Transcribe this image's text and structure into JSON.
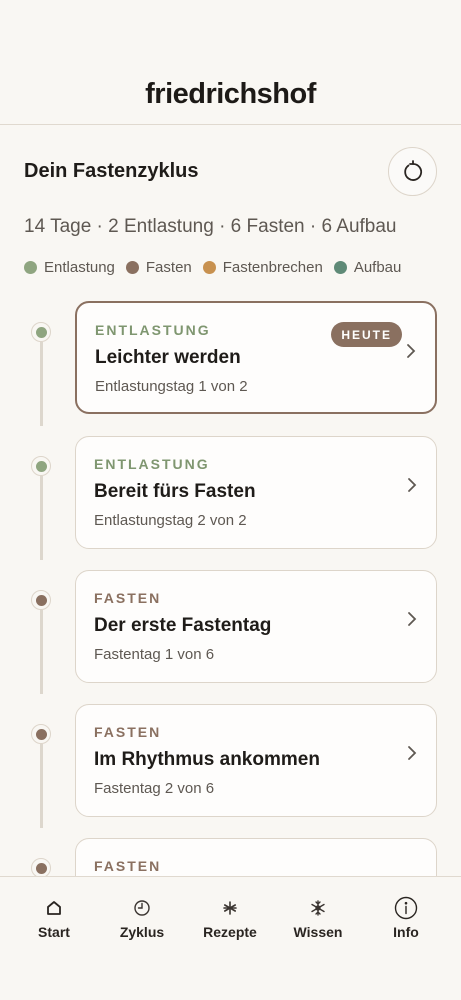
{
  "header": {
    "brand": "friedrichshof"
  },
  "section": {
    "title": "Dein Fastenzyklus",
    "summary": "14 Tage · 2 Entlastung · 6 Fasten · 6 Aufbau",
    "reset_icon": "refresh-icon"
  },
  "legend": [
    {
      "label": "Entlastung",
      "color": "#8fa580"
    },
    {
      "label": "Fasten",
      "color": "#8a7060"
    },
    {
      "label": "Fastenbrechen",
      "color": "#c8914f"
    },
    {
      "label": "Aufbau",
      "color": "#5f8a77"
    }
  ],
  "days": [
    {
      "phase": "ENTLASTUNG",
      "title": "Leichter werden",
      "subtitle": "Entlastungstag 1 von 2",
      "badge": "HEUTE",
      "phase_color": "#8fa580"
    },
    {
      "phase": "ENTLASTUNG",
      "title": "Bereit fürs Fasten",
      "subtitle": "Entlastungstag 2 von 2",
      "phase_color": "#8fa580"
    },
    {
      "phase": "FASTEN",
      "title": "Der erste Fastentag",
      "subtitle": "Fastentag 1 von 6",
      "phase_color": "#8a7060"
    },
    {
      "phase": "FASTEN",
      "title": "Im Rhythmus ankommen",
      "subtitle": "Fastentag 2 von 6",
      "phase_color": "#8a7060"
    },
    {
      "phase": "FASTEN",
      "title": "",
      "subtitle": "",
      "phase_color": "#8a7060"
    }
  ],
  "nav": [
    {
      "label": "Start",
      "icon": "home-icon"
    },
    {
      "label": "Zyklus",
      "icon": "clock-icon"
    },
    {
      "label": "Rezepte",
      "icon": "asterisk-icon"
    },
    {
      "label": "Wissen",
      "icon": "snowflake-icon"
    },
    {
      "label": "Info",
      "icon": "info-icon"
    }
  ]
}
